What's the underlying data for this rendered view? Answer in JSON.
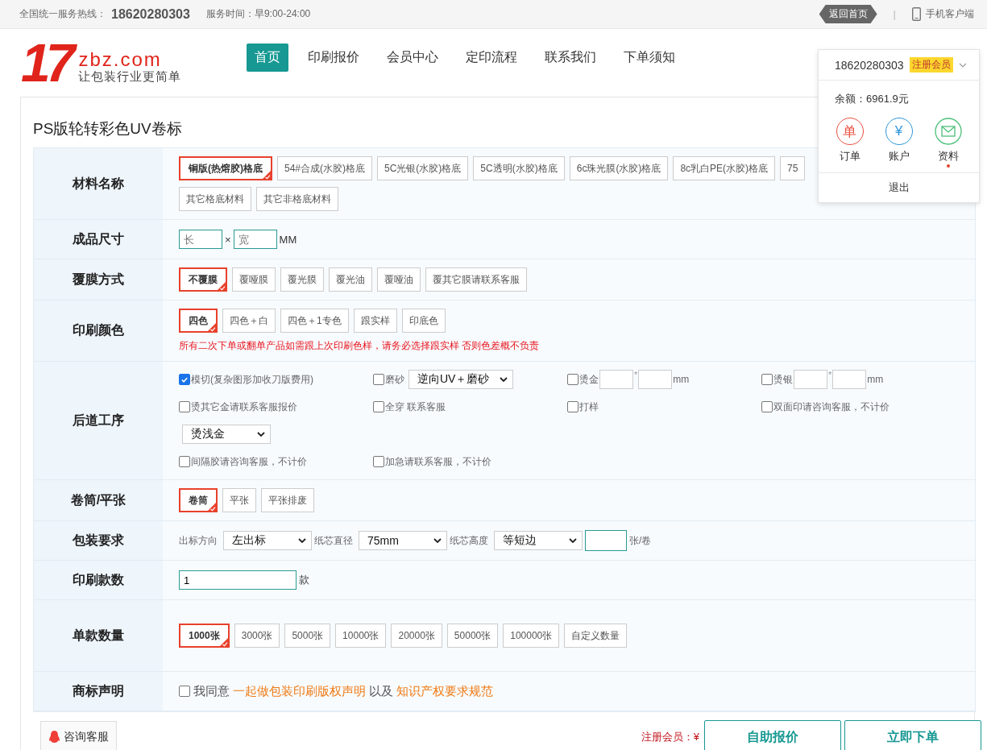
{
  "top_bar": {
    "hotline_label": "全国统一服务热线：",
    "hotline": "18620280303",
    "hours": "服务时间：早9:00-24:00",
    "home_link": "返回首页",
    "divider": "|",
    "mobile": "手机客户端"
  },
  "logo": {
    "mark": "17",
    "domain": "zbz.com",
    "slogan": "让包装行业更简单"
  },
  "nav": [
    {
      "label": "首页",
      "selected": true
    },
    {
      "label": "印刷报价",
      "selected": false
    },
    {
      "label": "会员中心",
      "selected": false
    },
    {
      "label": "定印流程",
      "selected": false
    },
    {
      "label": "联系我们",
      "selected": false
    },
    {
      "label": "下单须知",
      "selected": false
    }
  ],
  "user_menu": {
    "phone": "18620280303",
    "badge": "注册会员",
    "balance": "余额：6961.9元",
    "shortcuts": [
      {
        "kind": "order",
        "glyph": "单",
        "label": "订单",
        "dot": false
      },
      {
        "kind": "account",
        "glyph": "¥",
        "label": "账户",
        "dot": false
      },
      {
        "kind": "profile",
        "label": "资料",
        "dot": true
      }
    ],
    "logout": "退出"
  },
  "page_title": "PS版轮转彩色UV卷标",
  "rows": [
    {
      "label": "材料名称",
      "kind": "options",
      "options": [
        {
          "text": "铜版(热熔胶)格底",
          "selected": true
        },
        {
          "text": "54#合成(水胶)格底",
          "selected": false
        },
        {
          "text": "5C光银(水胶)格底",
          "selected": false
        },
        {
          "text": "5C透明(水胶)格底",
          "selected": false
        },
        {
          "text": "6c珠光膜(水胶)格底",
          "selected": false
        },
        {
          "text": "8c乳白PE(水胶)格底",
          "selected": false
        },
        {
          "text": "75",
          "selected": false
        },
        {
          "text": "其它格底材料",
          "selected": false
        },
        {
          "text": "其它非格底材料",
          "selected": false
        }
      ]
    },
    {
      "label": "成品尺寸",
      "kind": "size",
      "length_placeholder": "长",
      "sep": "×",
      "width_placeholder": "宽",
      "unit": "MM"
    },
    {
      "label": "覆膜方式",
      "kind": "options",
      "options": [
        {
          "text": "不覆膜",
          "selected": true
        },
        {
          "text": "覆哑膜",
          "selected": false
        },
        {
          "text": "覆光膜",
          "selected": false
        },
        {
          "text": "覆光油",
          "selected": false
        },
        {
          "text": "覆哑油",
          "selected": false
        },
        {
          "text": "覆其它膜请联系客服",
          "selected": false
        }
      ]
    },
    {
      "label": "印刷颜色",
      "kind": "options",
      "options": [
        {
          "text": "四色",
          "selected": true
        },
        {
          "text": "四色＋白",
          "selected": false
        },
        {
          "text": "四色＋1专色",
          "selected": false
        },
        {
          "text": "跟实样",
          "selected": false
        },
        {
          "text": "印底色",
          "selected": false
        }
      ],
      "note": "所有二次下单或翻单产品如需跟上次印刷色样，请务必选择跟实样 否则色差概不负责"
    },
    {
      "label": "后道工序",
      "kind": "processes",
      "items": [
        {
          "kind": "check",
          "label": "模切(复杂图形加收刀版费用)",
          "checked": true
        },
        {
          "kind": "check_select",
          "label": "磨砂",
          "checked": false,
          "value": "逆向UV＋磨砂"
        },
        {
          "kind": "check_size",
          "label": "烫金",
          "checked": false,
          "sep": "*",
          "unit": "mm"
        },
        {
          "kind": "check_size",
          "label": "烫银",
          "checked": false,
          "sep": "*",
          "unit": "mm"
        },
        {
          "kind": "check",
          "label": "烫其它金请联系客服报价",
          "checked": false
        },
        {
          "kind": "check",
          "label": "全穿 联系客服",
          "checked": false
        },
        {
          "kind": "check",
          "label": "打样",
          "checked": false
        },
        {
          "kind": "check",
          "label": "双面印请咨询客服，不计价",
          "checked": false
        },
        {
          "kind": "select",
          "value": "烫浅金"
        },
        {
          "kind": "check",
          "label": "间隔胶请咨询客服，不计价",
          "checked": false
        },
        {
          "kind": "check",
          "label": "加急请联系客服，不计价",
          "checked": false
        }
      ]
    },
    {
      "label": "卷筒/平张",
      "kind": "options",
      "options": [
        {
          "text": "卷筒",
          "selected": true
        },
        {
          "text": "平张",
          "selected": false
        },
        {
          "text": "平张排废",
          "selected": false
        }
      ]
    },
    {
      "label": "包装要求",
      "kind": "packaging",
      "fields": [
        {
          "kind": "select",
          "label": "出标方向",
          "value": "左出标"
        },
        {
          "kind": "select",
          "label": "纸芯直径",
          "value": "75mm"
        },
        {
          "kind": "select",
          "label": "纸芯高度",
          "value": "等短边"
        },
        {
          "kind": "input",
          "unit": "张/卷"
        }
      ]
    },
    {
      "label": "印刷款数",
      "kind": "count",
      "value": "1",
      "unit": "款"
    },
    {
      "label": "单款数量",
      "kind": "options",
      "options": [
        {
          "text": "1000张",
          "selected": true
        },
        {
          "text": "3000张",
          "selected": false
        },
        {
          "text": "5000张",
          "selected": false
        },
        {
          "text": "10000张",
          "selected": false
        },
        {
          "text": "20000张",
          "selected": false
        },
        {
          "text": "50000张",
          "selected": false
        },
        {
          "text": "100000张",
          "selected": false
        },
        {
          "text": "自定义数量",
          "selected": false
        }
      ]
    },
    {
      "label": "商标声明",
      "kind": "agreement",
      "checked": false,
      "text": "我同意",
      "link_1": "一起做包装印刷版权声明",
      "middle": "以及",
      "link_2": "知识产权要求规范"
    }
  ],
  "footer": {
    "service": "咨询客服",
    "price_label": "注册会员：¥",
    "quote": "自助报价",
    "order": "立即下单"
  }
}
